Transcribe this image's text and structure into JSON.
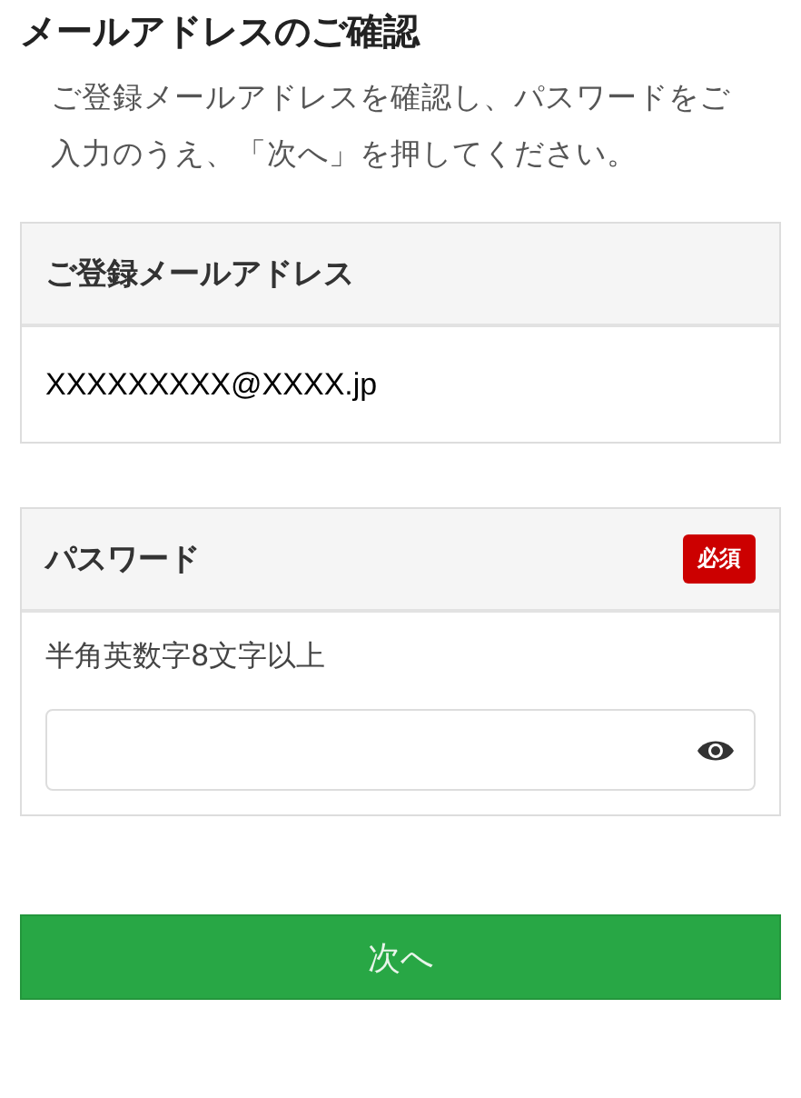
{
  "title": "メールアドレスのご確認",
  "description": "ご登録メールアドレスを確認し、パスワードをご入力のうえ、「次へ」を押してください。",
  "email_section": {
    "heading": "ご登録メールアドレス",
    "value": "XXXXXXXXX@XXXX.jp"
  },
  "password_section": {
    "heading": "パスワード",
    "required": true,
    "required_label": "必須",
    "hint": "半角英数字8文字以上"
  },
  "next_button": "次へ"
}
